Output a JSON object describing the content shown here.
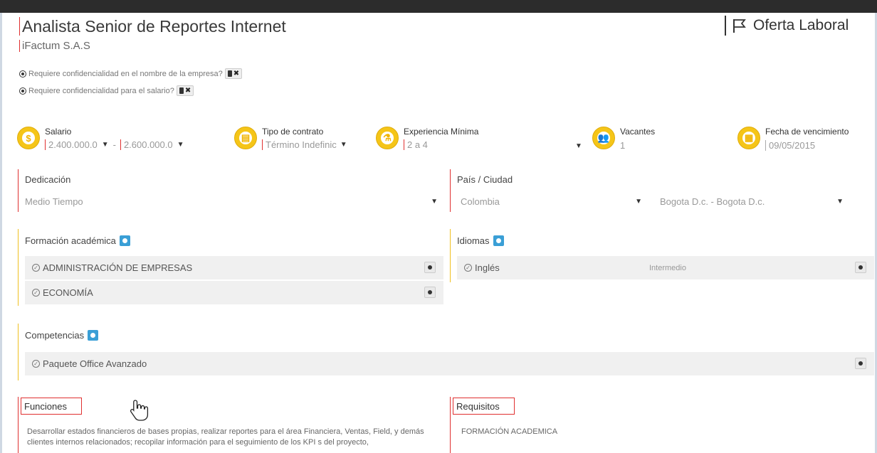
{
  "job": {
    "title": "Analista Senior de Reportes Internet",
    "company": "iFactum S.A.S",
    "offer_label": "Oferta Laboral"
  },
  "confidentiality": {
    "company_name_label": "Requiere confidencialidad en el nombre de la empresa?",
    "salary_label": "Requiere confidencialidad para el salario?"
  },
  "fields": {
    "salary": {
      "label": "Salario",
      "min": "2.400.000.0",
      "max": "2.600.000.0"
    },
    "contract": {
      "label": "Tipo de contrato",
      "value": "Término Indefinic"
    },
    "experience": {
      "label": "Experiencia Mínima",
      "value": "2 a 4"
    },
    "vacancies": {
      "label": "Vacantes",
      "value": "1"
    },
    "expiry": {
      "label": "Fecha de vencimiento",
      "value": "09/05/2015"
    }
  },
  "dedication": {
    "label": "Dedicación",
    "value": "Medio Tiempo"
  },
  "location": {
    "label": "País / Ciudad",
    "country": "Colombia",
    "city": "Bogota D.c. - Bogota D.c."
  },
  "education": {
    "label": "Formación académica",
    "items": [
      "ADMINISTRACIÓN DE EMPRESAS",
      "ECONOMÍA"
    ]
  },
  "languages": {
    "label": "Idiomas",
    "items": [
      {
        "name": "Inglés",
        "level": "Intermedio"
      }
    ]
  },
  "competencies": {
    "label": "Competencias",
    "items": [
      "Paquete Office Avanzado"
    ]
  },
  "functions": {
    "label": "Funciones",
    "text": "Desarrollar estados financieros de bases propias, realizar reportes para el área Financiera, Ventas, Field, y demás clientes internos relacionados; recopilar información para el seguimiento de los KPI s del proyecto,"
  },
  "requirements": {
    "label": "Requisitos",
    "text": "FORMACIÓN ACADEMICA"
  },
  "colors": {
    "accent_red": "#e03030",
    "icon_yellow": "#f5c518",
    "button_blue": "#3a9fd6"
  }
}
